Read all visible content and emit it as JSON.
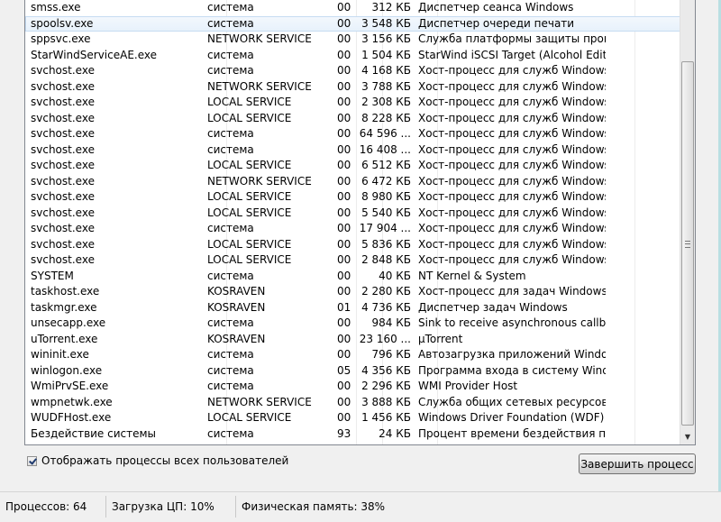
{
  "processes": [
    {
      "name": "smss.exe",
      "user": "система",
      "cpu": "00",
      "mem": "312 КБ",
      "desc": "Диспетчер сеанса  Windows"
    },
    {
      "name": "spoolsv.exe",
      "user": "система",
      "cpu": "00",
      "mem": "3 548 КБ",
      "desc": "Диспетчер очереди печати",
      "selected": true
    },
    {
      "name": "sppsvc.exe",
      "user": "NETWORK SERVICE",
      "cpu": "00",
      "mem": "3 156 КБ",
      "desc": "Служба платформы защиты програм..."
    },
    {
      "name": "StarWindServiceAE.exe",
      "user": "система",
      "cpu": "00",
      "mem": "1 504 КБ",
      "desc": "StarWind iSCSI Target (Alcohol Edition)"
    },
    {
      "name": "svchost.exe",
      "user": "система",
      "cpu": "00",
      "mem": "4 168 КБ",
      "desc": "Хост-процесс для служб Windows"
    },
    {
      "name": "svchost.exe",
      "user": "NETWORK SERVICE",
      "cpu": "00",
      "mem": "3 788 КБ",
      "desc": "Хост-процесс для служб Windows"
    },
    {
      "name": "svchost.exe",
      "user": "LOCAL SERVICE",
      "cpu": "00",
      "mem": "2 308 КБ",
      "desc": "Хост-процесс для служб Windows"
    },
    {
      "name": "svchost.exe",
      "user": "LOCAL SERVICE",
      "cpu": "00",
      "mem": "8 228 КБ",
      "desc": "Хост-процесс для служб Windows"
    },
    {
      "name": "svchost.exe",
      "user": "система",
      "cpu": "00",
      "mem": "64 596 ...",
      "desc": "Хост-процесс для служб Windows"
    },
    {
      "name": "svchost.exe",
      "user": "система",
      "cpu": "00",
      "mem": "16 408 ...",
      "desc": "Хост-процесс для служб Windows"
    },
    {
      "name": "svchost.exe",
      "user": "LOCAL SERVICE",
      "cpu": "00",
      "mem": "6 512 КБ",
      "desc": "Хост-процесс для служб Windows"
    },
    {
      "name": "svchost.exe",
      "user": "NETWORK SERVICE",
      "cpu": "00",
      "mem": "6 472 КБ",
      "desc": "Хост-процесс для служб Windows"
    },
    {
      "name": "svchost.exe",
      "user": "LOCAL SERVICE",
      "cpu": "00",
      "mem": "8 980 КБ",
      "desc": "Хост-процесс для служб Windows"
    },
    {
      "name": "svchost.exe",
      "user": "LOCAL SERVICE",
      "cpu": "00",
      "mem": "5 540 КБ",
      "desc": "Хост-процесс для служб Windows"
    },
    {
      "name": "svchost.exe",
      "user": "система",
      "cpu": "00",
      "mem": "17 904 ...",
      "desc": "Хост-процесс для служб Windows"
    },
    {
      "name": "svchost.exe",
      "user": "LOCAL SERVICE",
      "cpu": "00",
      "mem": "5 836 КБ",
      "desc": "Хост-процесс для служб Windows"
    },
    {
      "name": "svchost.exe",
      "user": "LOCAL SERVICE",
      "cpu": "00",
      "mem": "2 848 КБ",
      "desc": "Хост-процесс для служб Windows"
    },
    {
      "name": "SYSTEM",
      "user": "система",
      "cpu": "00",
      "mem": "40 КБ",
      "desc": "NT Kernel & System"
    },
    {
      "name": "taskhost.exe",
      "user": "KOSRAVEN",
      "cpu": "00",
      "mem": "2 280 КБ",
      "desc": "Хост-процесс для задач Windows"
    },
    {
      "name": "taskmgr.exe",
      "user": "KOSRAVEN",
      "cpu": "01",
      "mem": "4 736 КБ",
      "desc": "Диспетчер задач Windows"
    },
    {
      "name": "unsecapp.exe",
      "user": "система",
      "cpu": "00",
      "mem": "984 КБ",
      "desc": "Sink to receive asynchronous callbacks..."
    },
    {
      "name": "uTorrent.exe",
      "user": "KOSRAVEN",
      "cpu": "00",
      "mem": "23 160 ...",
      "desc": "µTorrent"
    },
    {
      "name": "wininit.exe",
      "user": "система",
      "cpu": "00",
      "mem": "796 КБ",
      "desc": "Автозагрузка приложений Windows"
    },
    {
      "name": "winlogon.exe",
      "user": "система",
      "cpu": "05",
      "mem": "4 356 КБ",
      "desc": "Программа входа в систему Windows"
    },
    {
      "name": "WmiPrvSE.exe",
      "user": "система",
      "cpu": "00",
      "mem": "2 296 КБ",
      "desc": "WMI Provider Host"
    },
    {
      "name": "wmpnetwk.exe",
      "user": "NETWORK SERVICE",
      "cpu": "00",
      "mem": "3 888 КБ",
      "desc": "Служба общих сетевых ресурсов про..."
    },
    {
      "name": "WUDFHost.exe",
      "user": "LOCAL SERVICE",
      "cpu": "00",
      "mem": "1 456 КБ",
      "desc": "Windows Driver Foundation (WDF) - х..."
    },
    {
      "name": "Бездействие системы",
      "user": "система",
      "cpu": "93",
      "mem": "24 КБ",
      "desc": "Процент времени бездействия проце..."
    }
  ],
  "options": {
    "show_all_users_label": "Отображать процессы всех пользователей",
    "show_all_users_checked": true
  },
  "actions": {
    "end_process_label": "Завершить процесс"
  },
  "status": {
    "processes": "Процессов: 64",
    "cpu": "Загрузка ЦП: 10%",
    "memory": "Физическая память: 38%"
  }
}
